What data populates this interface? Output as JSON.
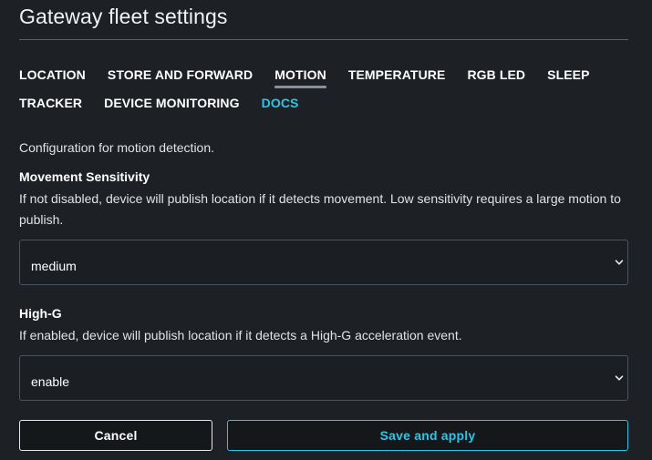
{
  "page": {
    "title": "Gateway fleet settings"
  },
  "tabs": [
    {
      "label": "LOCATION",
      "active": false
    },
    {
      "label": "STORE AND FORWARD",
      "active": false
    },
    {
      "label": "MOTION",
      "active": true
    },
    {
      "label": "TEMPERATURE",
      "active": false
    },
    {
      "label": "RGB LED",
      "active": false
    },
    {
      "label": "SLEEP",
      "active": false
    },
    {
      "label": "TRACKER",
      "active": false
    },
    {
      "label": "DEVICE MONITORING",
      "active": false
    },
    {
      "label": "DOCS",
      "active": false,
      "is_link": true
    }
  ],
  "section": {
    "description": "Configuration for motion detection."
  },
  "fields": {
    "movement_sensitivity": {
      "label": "Movement Sensitivity",
      "help": "If not disabled, device will publish location if it detects movement. Low sensitivity requires a large motion to publish.",
      "value": "medium"
    },
    "high_g": {
      "label": "High-G",
      "help": "If enabled, device will publish location if it detects a High-G acceleration event.",
      "value": "enable"
    }
  },
  "actions": {
    "cancel_label": "Cancel",
    "save_label": "Save and apply"
  },
  "icons": {
    "select_chevron": "chevron-down-icon"
  },
  "colors": {
    "background": "#1d2125",
    "accent": "#2ec4e6",
    "active_tab_underline": "#8a9098"
  }
}
